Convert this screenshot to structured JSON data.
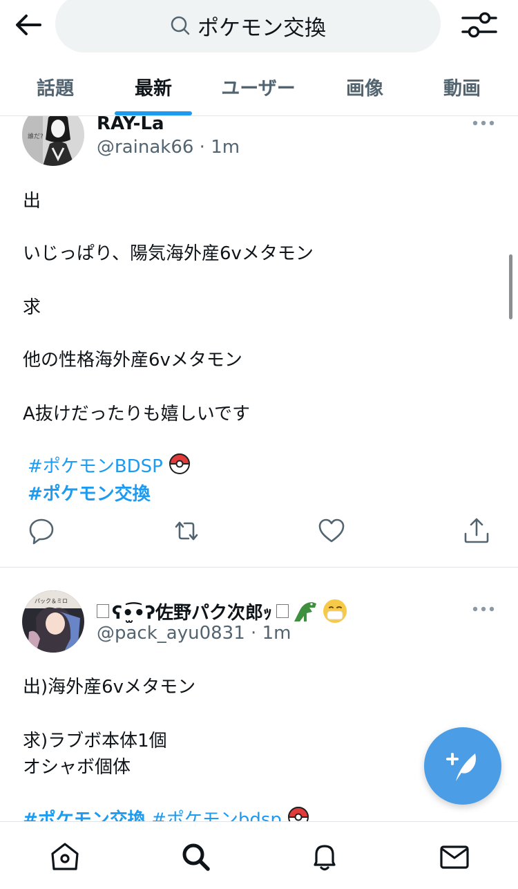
{
  "search": {
    "query": "ポケモン交換"
  },
  "tabs": [
    {
      "label": "話題"
    },
    {
      "label": "最新"
    },
    {
      "label": "ユーザー"
    },
    {
      "label": "画像"
    },
    {
      "label": "動画"
    }
  ],
  "active_tab": "最新",
  "tweets": [
    {
      "display_name": "RAY-La",
      "handle": "@rainak66",
      "time": "1m",
      "lines": [
        "出",
        "いじっぱり、陽気海外産6vメタモン",
        "求",
        "他の性格海外産6vメタモン",
        "A抜けだったりも嬉しいです"
      ],
      "hashtags": [
        "#ポケモンBDSP",
        "#ポケモン交換"
      ]
    },
    {
      "display_name": "ʕ•̫͡•ʔ佐野パク次郎ｯ",
      "handle": "@pack_ayu0831",
      "time": "1m",
      "lines": [
        "出)海外産6vメタモン",
        "求)ラブボ本体1個",
        "オシャボ個体"
      ],
      "hashtags": [
        "#ポケモン交換",
        "#ポケモンbdsp"
      ]
    }
  ],
  "colors": {
    "accent": "#1d9bf0",
    "fab": "#4b9ee6",
    "muted": "#536471"
  },
  "icons": [
    "back-arrow-icon",
    "search-icon",
    "filter-icon",
    "more-icon",
    "reply-icon",
    "retweet-icon",
    "like-icon",
    "share-icon",
    "compose-icon",
    "home-icon",
    "explore-icon",
    "notifications-icon",
    "messages-icon",
    "pokeball-icon",
    "crocodile-emoji",
    "mask-face-emoji"
  ]
}
